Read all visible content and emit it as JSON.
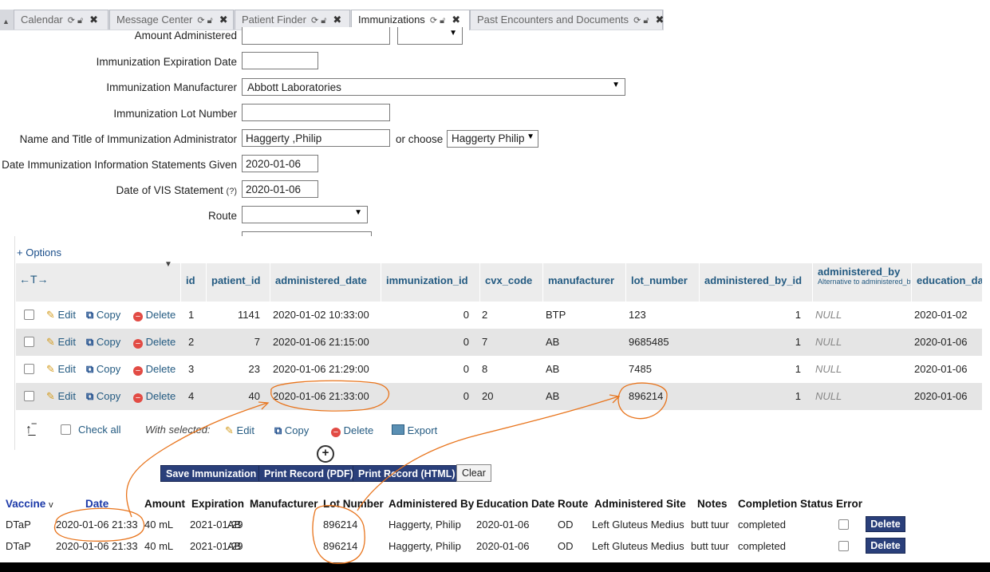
{
  "tabs": [
    {
      "label": "Calendar",
      "active": false
    },
    {
      "label": "Message Center",
      "active": false
    },
    {
      "label": "Patient Finder",
      "active": false
    },
    {
      "label": "Immunizations",
      "active": true
    },
    {
      "label": "Past Encounters and Documents",
      "active": false
    }
  ],
  "form": {
    "amount_label": "Amount Administered",
    "expiration_label": "Immunization Expiration Date",
    "manufacturer_label": "Immunization Manufacturer",
    "manufacturer_value": "Abbott Laboratories",
    "lot_label": "Immunization Lot Number",
    "admin_label": "Name and Title of Immunization Administrator",
    "admin_value": "Haggerty ,Philip",
    "or_choose": "or choose",
    "admin_select": "Haggerty Philip",
    "vis_given_label": "Date Immunization Information Statements Given",
    "vis_given_value": "2020-01-06",
    "vis_stmt_label": "Date of VIS Statement",
    "vis_help": "(?)",
    "vis_stmt_value": "2020-01-06",
    "route_label": "Route"
  },
  "grid": {
    "options_label": "+ Options",
    "columns": [
      "id",
      "patient_id",
      "administered_date",
      "immunization_id",
      "cvx_code",
      "manufacturer",
      "lot_number",
      "administered_by_id",
      "administered_by",
      "education_da"
    ],
    "administered_by_sub": "Alternative to administered_by_id",
    "action_edit": "Edit",
    "action_copy": "Copy",
    "action_delete": "Delete",
    "rows": [
      {
        "id": "1",
        "patient_id": "1141",
        "administered_date": "2020-01-02 10:33:00",
        "immunization_id": "0",
        "cvx_code": "2",
        "manufacturer": "BTP",
        "lot_number": "123",
        "administered_by_id": "1",
        "administered_by": "NULL",
        "education_date": "2020-01-02"
      },
      {
        "id": "2",
        "patient_id": "7",
        "administered_date": "2020-01-06 21:15:00",
        "immunization_id": "0",
        "cvx_code": "7",
        "manufacturer": "AB",
        "lot_number": "9685485",
        "administered_by_id": "1",
        "administered_by": "NULL",
        "education_date": "2020-01-06"
      },
      {
        "id": "3",
        "patient_id": "23",
        "administered_date": "2020-01-06 21:29:00",
        "immunization_id": "0",
        "cvx_code": "8",
        "manufacturer": "AB",
        "lot_number": "7485",
        "administered_by_id": "1",
        "administered_by": "NULL",
        "education_date": "2020-01-06"
      },
      {
        "id": "4",
        "patient_id": "40",
        "administered_date": "2020-01-06 21:33:00",
        "immunization_id": "0",
        "cvx_code": "20",
        "manufacturer": "AB",
        "lot_number": "896214",
        "administered_by_id": "1",
        "administered_by": "NULL",
        "education_date": "2020-01-06"
      }
    ],
    "check_all": "Check all",
    "with_selected": "With selected:",
    "bulk_edit": "Edit",
    "bulk_copy": "Copy",
    "bulk_delete": "Delete",
    "bulk_export": "Export"
  },
  "buttons": {
    "save": "Save Immunization",
    "print_pdf": "Print Record (PDF)",
    "print_html": "Print Record (HTML)",
    "clear": "Clear"
  },
  "history": {
    "headers": {
      "vaccine": "Vaccine",
      "sort_indicator": "v",
      "date": "Date",
      "amount": "Amount",
      "expiration": "Expiration",
      "manufacturer": "Manufacturer",
      "lot": "Lot Number",
      "admin_by": "Administered By",
      "edu_date": "Education Date",
      "route": "Route",
      "site": "Administered Site",
      "notes": "Notes",
      "status": "Completion Status",
      "error": "Error"
    },
    "delete_label": "Delete",
    "rows": [
      {
        "vaccine": "DTaP",
        "date": "2020-01-06 21:33",
        "amount": "40 mL",
        "expiration": "2021-01-29",
        "manufacturer": "AB",
        "lot": "896214",
        "admin_by": "Haggerty, Philip",
        "edu_date": "2020-01-06",
        "route": "OD",
        "site": "Left Gluteus Medius",
        "notes": "butt tuur",
        "status": "completed"
      },
      {
        "vaccine": "DTaP",
        "date": "2020-01-06 21:33",
        "amount": "40 mL",
        "expiration": "2021-01-29",
        "manufacturer": "AB",
        "lot": "896214",
        "admin_by": "Haggerty, Philip",
        "edu_date": "2020-01-06",
        "route": "OD",
        "site": "Left Gluteus Medius",
        "notes": "butt tuur",
        "status": "completed"
      }
    ]
  },
  "colors": {
    "annotation": "#e8741c",
    "link": "#235a81",
    "button": "#2a3f7a"
  }
}
